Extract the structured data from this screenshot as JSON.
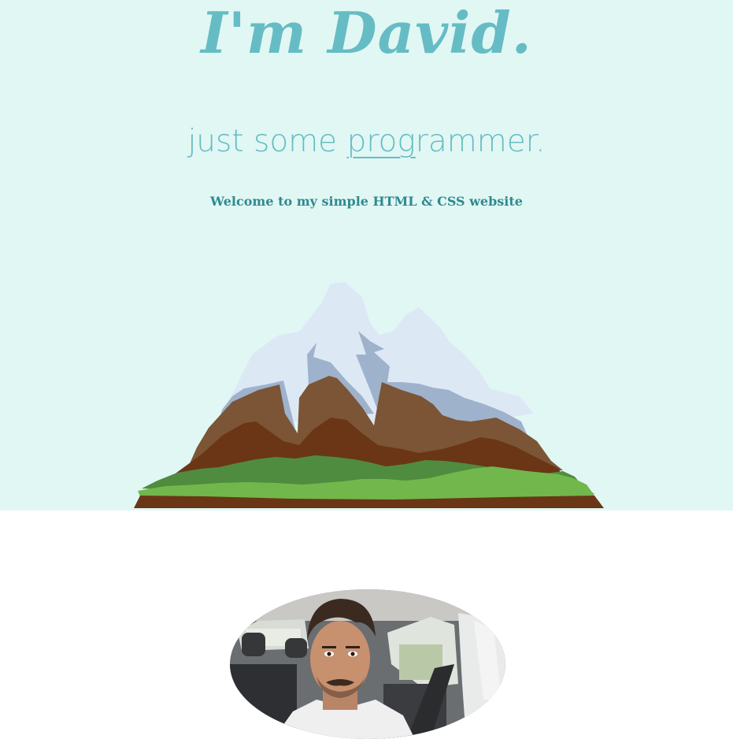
{
  "hero": {
    "title": "I'm David.",
    "subtitle_parts": [
      "just some ",
      "prog",
      "rammer."
    ],
    "tagline": "Welcome to my simple HTML & CSS website"
  },
  "illustration": {
    "subject": "mountain-illustration",
    "colors": {
      "snow": "#dde8f5",
      "snow_shadow": "#9fb2cc",
      "rock": "#7b5535",
      "rock_dark": "#6a3616",
      "grass_dark": "#4f8c3f",
      "grass_light": "#72b74b",
      "soil": "#6a3616"
    }
  },
  "about": {
    "photo_subject": "profile-photo"
  },
  "colors": {
    "hero_bg": "#e1f7f4",
    "accent": "#66bcc4",
    "tagline": "#2e8a8f",
    "page_bg": "#ffffff"
  }
}
